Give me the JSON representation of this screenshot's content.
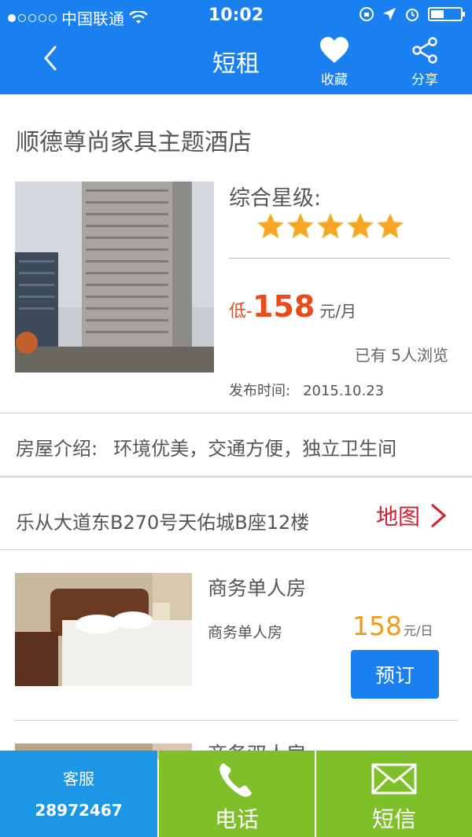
{
  "status_bar": {
    "carrier": "中国联通",
    "time": "10:02",
    "signal_dots_filled": 1,
    "signal_dots_total": 5,
    "battery_level": 0.45
  },
  "nav": {
    "title": "短租",
    "favorite_label": "收藏",
    "share_label": "分享"
  },
  "hotel": {
    "name": "顺德尊尚家具主题酒店",
    "rating_label": "综合星级:",
    "star_rating": 5,
    "price_prefix": "低-",
    "price": "158",
    "price_unit": "元/月",
    "views": "已有 5人浏览",
    "publish_label": "发布时间:",
    "publish_date": "2015.10.23"
  },
  "intro": {
    "label": "房屋介绍:",
    "text": "环境优美，交通方便，独立卫生间"
  },
  "address": {
    "text": "乐从大道东B270号天佑城B座12楼",
    "map_label": "地图"
  },
  "rooms": [
    {
      "name": "商务单人房",
      "subtitle": "商务单人房",
      "price": "158",
      "price_unit": "元/日",
      "book_label": "预订"
    },
    {
      "name": "商务双人房"
    }
  ],
  "bottom_bar": {
    "service_label": "客服",
    "service_number": "28972467",
    "phone_label": "电话",
    "sms_label": "短信"
  },
  "colors": {
    "primary": "#1a80f0",
    "price_red": "#e84c1a",
    "price_orange": "#f29a1a",
    "map_red": "#d0202e",
    "green": "#7fc02a",
    "service_blue": "#1c96e6"
  },
  "icons": [
    "back-arrow-icon",
    "heart-icon",
    "share-icon",
    "star-icon",
    "chevron-right-icon",
    "phone-icon",
    "envelope-icon",
    "wifi-icon",
    "lock-rotation-icon",
    "location-arrow-icon",
    "alarm-icon",
    "battery-icon"
  ]
}
